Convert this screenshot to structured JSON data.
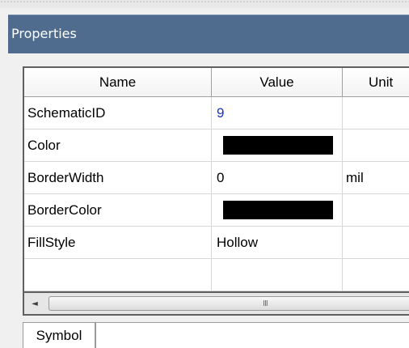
{
  "panel": {
    "title": "Properties"
  },
  "grid": {
    "columns": [
      "Name",
      "Value",
      "Unit"
    ],
    "rows": [
      {
        "name": "SchematicID",
        "value": "9",
        "unit": "",
        "value_type": "number"
      },
      {
        "name": "Color",
        "value": "",
        "unit": "",
        "value_type": "color",
        "color": "#000000"
      },
      {
        "name": "BorderWidth",
        "value": "0",
        "unit": "mil",
        "value_type": "text"
      },
      {
        "name": "BorderColor",
        "value": "",
        "unit": "",
        "value_type": "color",
        "color": "#000000"
      },
      {
        "name": "FillStyle",
        "value": "Hollow",
        "unit": "",
        "value_type": "text"
      },
      {
        "name": "",
        "value": "",
        "unit": "",
        "value_type": "text"
      }
    ]
  },
  "scrollbar": {
    "left_arrow": "◄",
    "grip": "III"
  },
  "tabs": {
    "active": "Symbol"
  },
  "colors": {
    "titlebar": "#4f6c8f",
    "number_value": "#1e32c8"
  }
}
